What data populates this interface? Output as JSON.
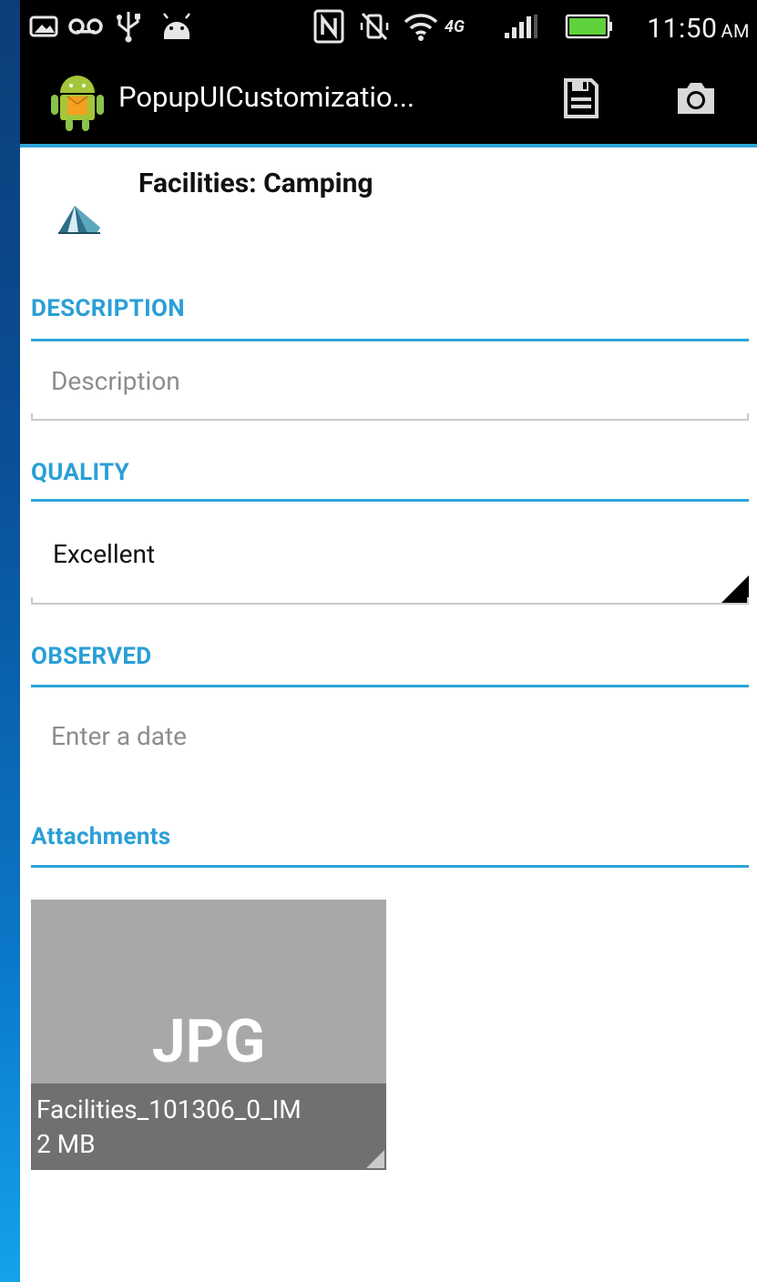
{
  "status_bar": {
    "icons": [
      "image-icon",
      "voicemail-icon",
      "usb-icon",
      "android-debug-icon",
      "nfc-icon",
      "vibrate-off-icon",
      "wifi-icon",
      "4g-icon",
      "signal-icon",
      "battery-icon"
    ],
    "time": "11:50",
    "ampm": "AM"
  },
  "action_bar": {
    "title": "PopupUICustomizatio...",
    "icons": [
      "save-icon",
      "camera-icon"
    ]
  },
  "feature": {
    "title": "Facilities: Camping",
    "icon": "tent-icon"
  },
  "fields": {
    "description": {
      "label": "DESCRIPTION",
      "placeholder": "Description"
    },
    "quality": {
      "label": "QUALITY",
      "value": "Excellent"
    },
    "observed": {
      "label": "OBSERVED",
      "placeholder": "Enter a date"
    }
  },
  "attachments": {
    "label": "Attachments",
    "items": [
      {
        "type": "JPG",
        "name": "Facilities_101306_0_IM",
        "size": "2 MB"
      }
    ]
  },
  "colors": {
    "accent": "#2fa4d9",
    "action_bar": "#000000",
    "attachment_bg": "#a7a9a8",
    "attachment_meta_bg": "#6f7170"
  }
}
